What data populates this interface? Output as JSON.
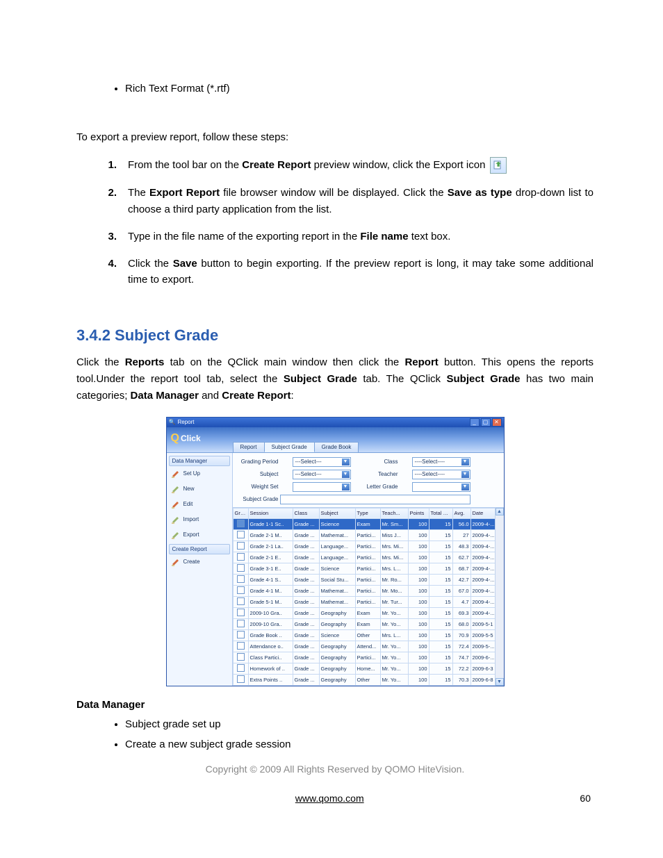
{
  "intro_bullet": "Rich Text Format (*.rtf)",
  "export_preview_lead": "To export a preview report, follow these steps:",
  "steps": {
    "s1a": "From the tool bar on the ",
    "s1b": "Create Report",
    "s1c": " preview window, click the Export icon ",
    "s2a": "The ",
    "s2b": "Export Report",
    "s2c": " file browser window will be displayed. Click the ",
    "s2d": "Save as type",
    "s2e": " drop-down list to choose a third party application from the list.",
    "s3a": "Type in the file name of the exporting report in the ",
    "s3b": "File name",
    "s3c": " text box.",
    "s4a": "Click the ",
    "s4b": "Save",
    "s4c": " button to begin exporting. If the preview report is long, it may take some additional time to export."
  },
  "section_heading": "3.4.2 Subject Grade",
  "section_para": {
    "a": "Click the ",
    "b": "Reports",
    "c": " tab on the QClick main window then click the ",
    "d": "Report",
    "e": " button. This opens the reports tool.Under the report tool tab, select the ",
    "f": "Subject Grade",
    "g": " tab. The QClick ",
    "h": "Subject Grade",
    "i": " has two main categories; ",
    "j": "Data Manager",
    "k": " and ",
    "l": "Create Report",
    "m": ":"
  },
  "app": {
    "window_title": "Report",
    "logo": {
      "q": "Q",
      "rest": "Click"
    },
    "tabs": [
      "Report",
      "Subject Grade",
      "Grade Book"
    ],
    "active_tab_index": 1,
    "sidebar": {
      "section1_title": "Data Manager",
      "items1": [
        "Set Up",
        "New",
        "Edit",
        "Import",
        "Export"
      ],
      "section2_title": "Create Report",
      "items2": [
        "Create"
      ]
    },
    "filters": {
      "grading_period_label": "Grading Period",
      "grading_period_value": "---Select---",
      "class_label": "Class",
      "class_value": "----Select----",
      "subject_label": "Subject",
      "subject_value": "---Select---",
      "teacher_label": "Teacher",
      "teacher_value": "----Select----",
      "weight_set_label": "Weight Set",
      "weight_set_value": "",
      "letter_grade_label": "Letter Grade",
      "letter_grade_value": "",
      "subject_grade_label": "Subject Grade",
      "subject_grade_value": ""
    },
    "columns": [
      "Grade",
      "Session",
      "Class",
      "Subject",
      "Type",
      "Teach...",
      "Points",
      "Total S...",
      "Avg.",
      "Date"
    ],
    "rows": [
      {
        "sel": true,
        "session": "Grade 1-1 Sc..",
        "class": "Grade ...",
        "subject": "Science",
        "type": "Exam",
        "teach": "Mr. Sm...",
        "points": "100",
        "total": "15",
        "avg": "56.0",
        "date": "2009-4-..."
      },
      {
        "sel": false,
        "session": "Grade 2-1 M..",
        "class": "Grade ...",
        "subject": "Mathemat...",
        "type": "Partici...",
        "teach": "Miss J...",
        "points": "100",
        "total": "15",
        "avg": "27",
        "date": "2009-4-..."
      },
      {
        "sel": false,
        "session": "Grade 2-1 La..",
        "class": "Grade ...",
        "subject": "Language...",
        "type": "Partici...",
        "teach": "Mrs. Mi...",
        "points": "100",
        "total": "15",
        "avg": "48.3",
        "date": "2009-4-..."
      },
      {
        "sel": false,
        "session": "Grade 2-1 E..",
        "class": "Grade ...",
        "subject": "Language...",
        "type": "Partici...",
        "teach": "Mrs. Mi...",
        "points": "100",
        "total": "15",
        "avg": "62.7",
        "date": "2009-4-..."
      },
      {
        "sel": false,
        "session": "Grade 3-1 E..",
        "class": "Grade ...",
        "subject": "Science",
        "type": "Partici...",
        "teach": "Mrs. L...",
        "points": "100",
        "total": "15",
        "avg": "68.7",
        "date": "2009-4-..."
      },
      {
        "sel": false,
        "session": "Grade 4-1 S..",
        "class": "Grade ...",
        "subject": "Social Stu...",
        "type": "Partici...",
        "teach": "Mr. Ro...",
        "points": "100",
        "total": "15",
        "avg": "42.7",
        "date": "2009-4-..."
      },
      {
        "sel": false,
        "session": "Grade 4-1 M..",
        "class": "Grade ...",
        "subject": "Mathemat...",
        "type": "Partici...",
        "teach": "Mr. Mo...",
        "points": "100",
        "total": "15",
        "avg": "67.0",
        "date": "2009-4-..."
      },
      {
        "sel": false,
        "session": "Grade 5-1 M..",
        "class": "Grade ...",
        "subject": "Mathemat...",
        "type": "Partici...",
        "teach": "Mr. Tur...",
        "points": "100",
        "total": "15",
        "avg": "4.7",
        "date": "2009-4-..."
      },
      {
        "sel": false,
        "session": "2009-10 Gra..",
        "class": "Grade ...",
        "subject": "Geography",
        "type": "Exam",
        "teach": "Mr. Yo...",
        "points": "100",
        "total": "15",
        "avg": "69.3",
        "date": "2009-4-..."
      },
      {
        "sel": false,
        "session": "2009-10 Gra..",
        "class": "Grade ...",
        "subject": "Geography",
        "type": "Exam",
        "teach": "Mr. Yo...",
        "points": "100",
        "total": "15",
        "avg": "68.0",
        "date": "2009-5-1"
      },
      {
        "sel": false,
        "session": "Grade Book ..",
        "class": "Grade ...",
        "subject": "Science",
        "type": "Other",
        "teach": "Mrs. L...",
        "points": "100",
        "total": "15",
        "avg": "70.9",
        "date": "2009-5-5"
      },
      {
        "sel": false,
        "session": "Attendance o..",
        "class": "Grade ...",
        "subject": "Geography",
        "type": "Attend...",
        "teach": "Mr. Yo...",
        "points": "100",
        "total": "15",
        "avg": "72.4",
        "date": "2009-5-..."
      },
      {
        "sel": false,
        "session": "Class Partici..",
        "class": "Grade ...",
        "subject": "Geography",
        "type": "Partici...",
        "teach": "Mr. Yo...",
        "points": "100",
        "total": "15",
        "avg": "74.7",
        "date": "2009-6-..."
      },
      {
        "sel": false,
        "session": "Homework of ..",
        "class": "Grade ...",
        "subject": "Geography",
        "type": "Home...",
        "teach": "Mr. Yo...",
        "points": "100",
        "total": "15",
        "avg": "72.2",
        "date": "2009-6-3"
      },
      {
        "sel": false,
        "session": "Extra Points ..",
        "class": "Grade ...",
        "subject": "Geography",
        "type": "Other",
        "teach": "Mr. Yo...",
        "points": "100",
        "total": "15",
        "avg": "70.3",
        "date": "2009-6-8"
      }
    ]
  },
  "post_heading": "Data Manager",
  "post_bullets": [
    "Subject grade set up",
    "Create a new subject grade session"
  ],
  "copyright": "Copyright © 2009 All Rights Reserved by QOMO HiteVision.",
  "footer_link": "www.qomo.com",
  "page_number": "60"
}
